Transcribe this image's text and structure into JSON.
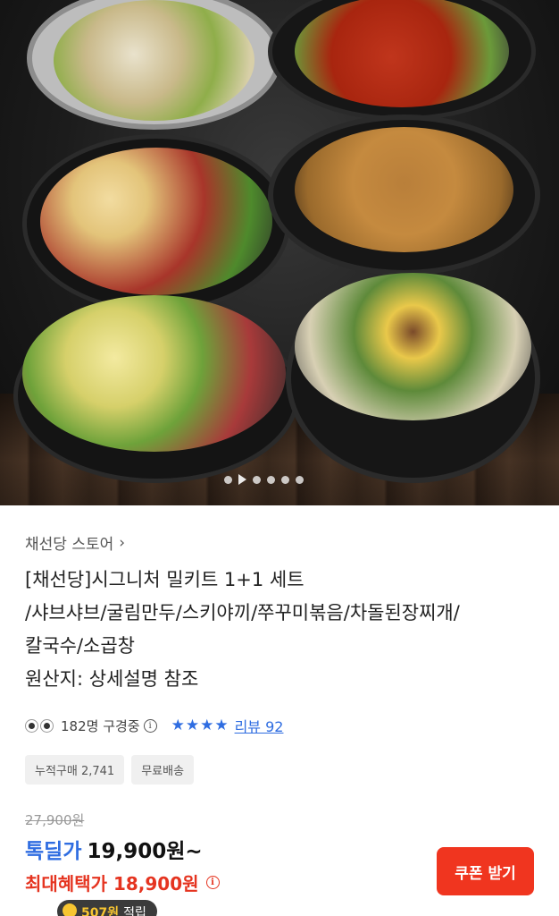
{
  "hero": {
    "image_name": "milkit-set-photo",
    "dots_count": 5
  },
  "store": {
    "name": "채선당 스토어",
    "chevron": "›"
  },
  "product": {
    "title_lines": [
      "[채선당]시그니처 밀키트 1+1 세트",
      "/샤브샤브/굴림만두/스키야끼/쭈꾸미볶음/차돌된장찌개/",
      "칼국수/소곱창",
      "원산지: 상세설명 참조"
    ]
  },
  "social": {
    "viewers": "182명 구경중",
    "info_icon": "i",
    "stars": "★★★★",
    "review": "리뷰 92"
  },
  "chips": [
    "누적구매 2,741",
    "무료배송"
  ],
  "price": {
    "original": "27,900원",
    "deal_label": "톡딜가",
    "deal_amount": "19,900원~",
    "benefit_label": "최대혜택가 18,900원",
    "coupon_button": "쿠폰 받기"
  },
  "points": {
    "value": "507원",
    "label": "적립"
  },
  "colors": {
    "accent_blue": "#2f6de1",
    "accent_red": "#f0351f",
    "benefit_red": "#e53420"
  }
}
